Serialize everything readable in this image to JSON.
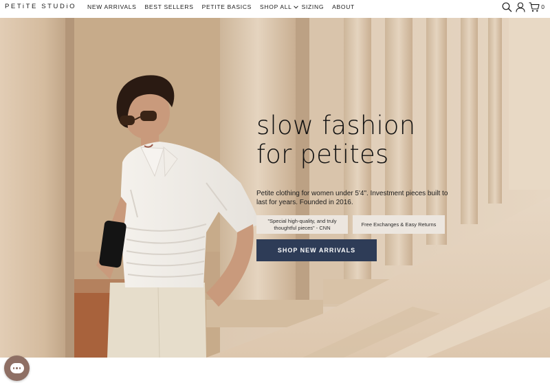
{
  "header": {
    "logo": "PETiTE STUDiO",
    "nav": [
      {
        "label": "NEW ARRIVALS"
      },
      {
        "label": "BEST SELLERS"
      },
      {
        "label": "PETITE BASICS"
      },
      {
        "label": "SHOP ALL"
      },
      {
        "label": "SIZING"
      },
      {
        "label": "ABOUT"
      }
    ],
    "icons": [
      "search-icon",
      "account-icon",
      "cart-icon"
    ],
    "cart_count": "0"
  },
  "hero": {
    "headline_line1": "slow fashion",
    "headline_line2": "for petites",
    "subtext": "Petite clothing for women under 5'4\". Investment pieces built to last for years. Founded in 2016.",
    "quote_badge": "\"Special high-quality, and truly thoughtful pieces\" - CNN",
    "returns_badge": "Free Exchanges & Easy Returns",
    "cta_label": "SHOP NEW ARRIVALS"
  },
  "colors": {
    "cta_background": "#2e3c57",
    "badge_background": "#ece6df",
    "chat_bubble": "#8e6f64"
  }
}
